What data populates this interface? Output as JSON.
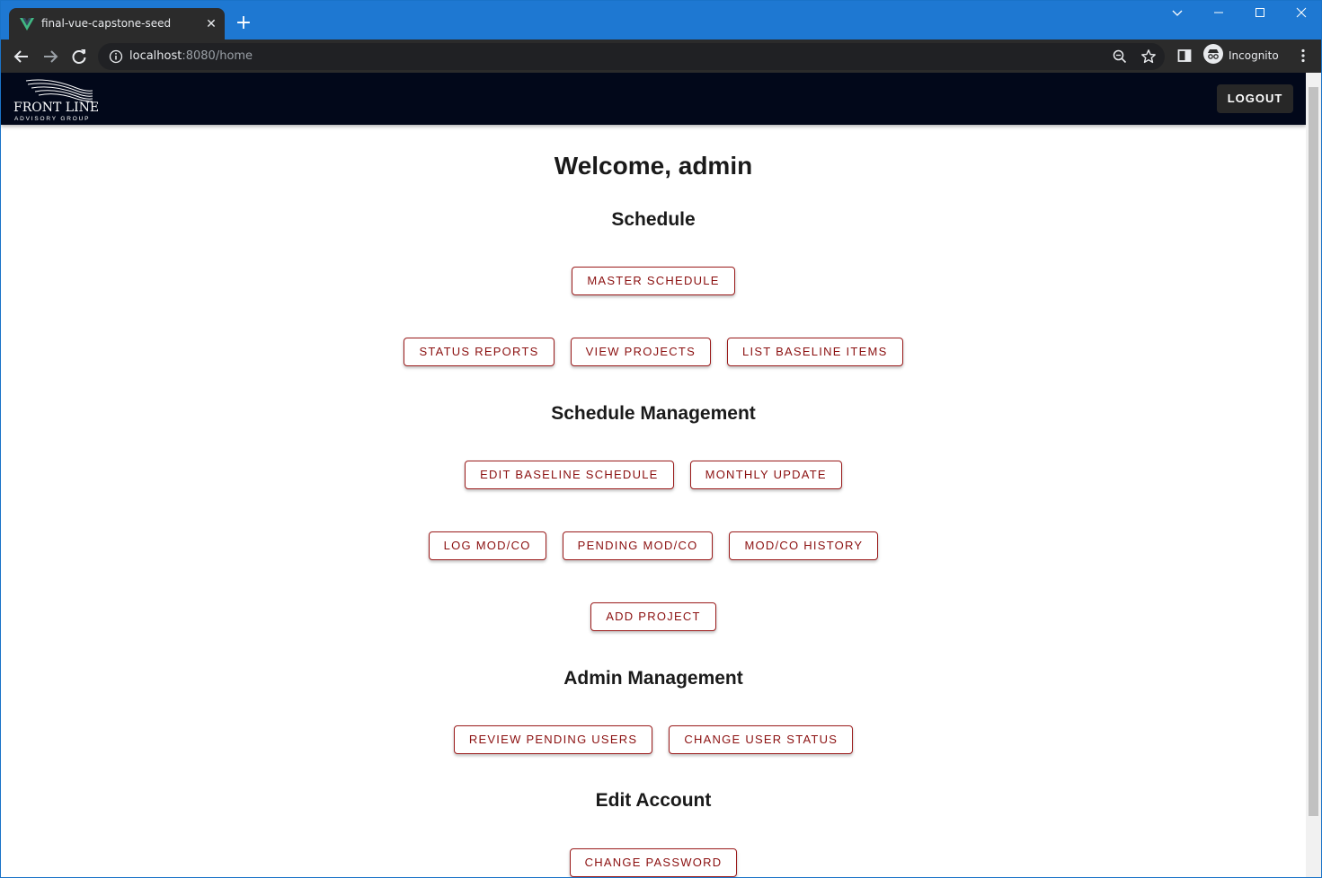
{
  "browser": {
    "tab_title": "final-vue-capstone-seed",
    "url_host": "localhost",
    "url_path": ":8080/home",
    "profile_label": "Incognito",
    "new_tab_symbol": "+",
    "close_symbol": "✕"
  },
  "colors": {
    "accent": "#8b1010",
    "appbar": "#02081a",
    "titlebar": "#1e78d2"
  },
  "header": {
    "logo_main": "FRONT LINE",
    "logo_sub": "ADVISORY GROUP",
    "logout_label": "LOGOUT"
  },
  "main": {
    "welcome": "Welcome, admin",
    "sections": {
      "schedule": {
        "title": "Schedule",
        "master_schedule": "MASTER SCHEDULE",
        "status_reports": "STATUS REPORTS",
        "view_projects": "VIEW PROJECTS",
        "list_baseline_items": "LIST BASELINE ITEMS"
      },
      "schedule_management": {
        "title": "Schedule Management",
        "edit_baseline_schedule": "EDIT BASELINE SCHEDULE",
        "monthly_update": "MONTHLY UPDATE",
        "log_modco": "LOG MOD/CO",
        "pending_modco": "PENDING MOD/CO",
        "modco_history": "MOD/CO HISTORY",
        "add_project": "ADD PROJECT"
      },
      "admin_management": {
        "title": "Admin Management",
        "review_pending_users": "REVIEW PENDING USERS",
        "change_user_status": "CHANGE USER STATUS"
      },
      "edit_account": {
        "title": "Edit Account",
        "change_password": "CHANGE PASSWORD"
      }
    }
  }
}
